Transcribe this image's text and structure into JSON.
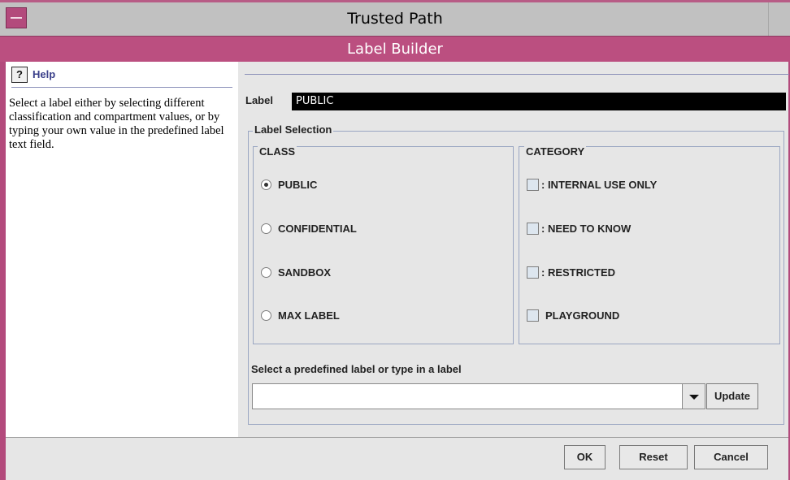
{
  "window": {
    "title": "Trusted Path",
    "banner": "Label Builder",
    "accent_color": "#bb4f80"
  },
  "help": {
    "icon": "help-icon",
    "title": "Help",
    "text": "Select a label either by selecting different classification and compartment values, or by typing your own value in the predefined label text field."
  },
  "label": {
    "caption": "Label",
    "value": "PUBLIC"
  },
  "label_selection": {
    "legend": "Label Selection",
    "class_legend": "CLASS",
    "category_legend": "CATEGORY",
    "classes": [
      {
        "label": "PUBLIC",
        "selected": true
      },
      {
        "label": "CONFIDENTIAL",
        "selected": false
      },
      {
        "label": "SANDBOX",
        "selected": false
      },
      {
        "label": "MAX LABEL",
        "selected": false
      }
    ],
    "categories": [
      {
        "label": ": INTERNAL USE ONLY",
        "checked": false
      },
      {
        "label": ": NEED TO KNOW",
        "checked": false
      },
      {
        "label": ": RESTRICTED",
        "checked": false
      },
      {
        "label": "PLAYGROUND",
        "checked": false
      }
    ]
  },
  "predefined": {
    "caption": "Select a predefined label or type in a label",
    "value": "",
    "update_label": "Update"
  },
  "buttons": {
    "ok": "OK",
    "reset": "Reset",
    "cancel": "Cancel"
  }
}
